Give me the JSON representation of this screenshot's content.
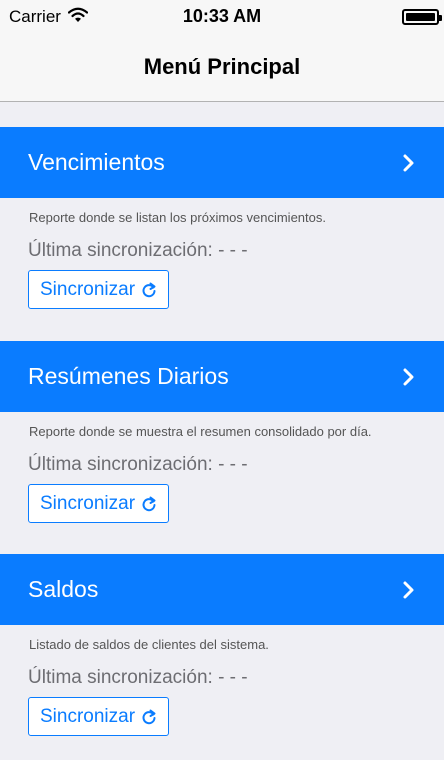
{
  "status_bar": {
    "carrier": "Carrier",
    "time": "10:33 AM"
  },
  "nav": {
    "title": "Menú Principal"
  },
  "sections": [
    {
      "title": "Vencimientos",
      "description": "Reporte donde se listan los próximos vencimientos.",
      "last_sync": "Última sincronización: - - -",
      "button_label": "Sincronizar"
    },
    {
      "title": "Resúmenes Diarios",
      "description": "Reporte donde se muestra el resumen consolidado por día.",
      "last_sync": "Última sincronización: - - -",
      "button_label": "Sincronizar"
    },
    {
      "title": "Saldos",
      "description": "Listado de saldos de clientes del sistema.",
      "last_sync": "Última sincronización: - - -",
      "button_label": "Sincronizar"
    }
  ],
  "colors": {
    "accent": "#0a7cff",
    "background": "#efeff4",
    "bar": "#f7f7f7"
  },
  "icons": {
    "wifi": "wifi-icon",
    "battery": "battery-icon",
    "chevron": "chevron-right-icon",
    "refresh": "refresh-icon"
  }
}
